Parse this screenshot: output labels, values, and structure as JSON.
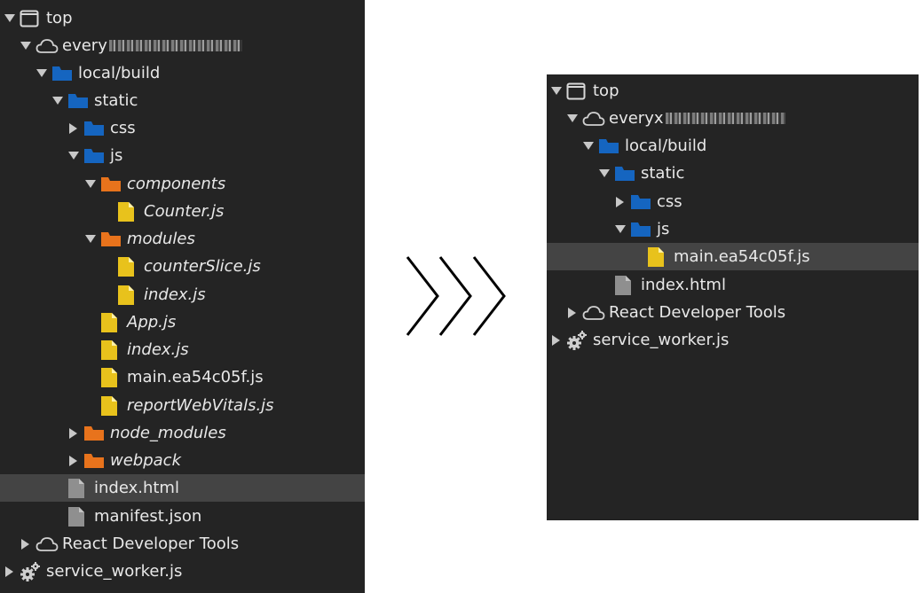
{
  "left": {
    "rows": [
      {
        "label": "top"
      },
      {
        "label": "every"
      },
      {
        "label": "local/build"
      },
      {
        "label": "static"
      },
      {
        "label": "css"
      },
      {
        "label": "js"
      },
      {
        "label": "components"
      },
      {
        "label": "Counter.js"
      },
      {
        "label": "modules"
      },
      {
        "label": "counterSlice.js"
      },
      {
        "label": "index.js"
      },
      {
        "label": "App.js"
      },
      {
        "label": "index.js"
      },
      {
        "label": "main.ea54c05f.js"
      },
      {
        "label": "reportWebVitals.js"
      },
      {
        "label": "node_modules"
      },
      {
        "label": "webpack"
      },
      {
        "label": "index.html"
      },
      {
        "label": "manifest.json"
      },
      {
        "label": "React Developer Tools"
      },
      {
        "label": "service_worker.js"
      }
    ]
  },
  "right": {
    "rows": [
      {
        "label": "top"
      },
      {
        "label": "everyx"
      },
      {
        "label": "local/build"
      },
      {
        "label": "static"
      },
      {
        "label": "css"
      },
      {
        "label": "js"
      },
      {
        "label": "main.ea54c05f.js"
      },
      {
        "label": "index.html"
      },
      {
        "label": "React Developer Tools"
      },
      {
        "label": "service_worker.js"
      }
    ]
  },
  "colors": {
    "panel_bg": "#242424",
    "selected_bg": "#444444",
    "text": "#e8e8e8",
    "folder_blue": "#1565c0",
    "folder_orange": "#e8731c",
    "file_yellow": "#e8c21c",
    "file_gray": "#8f8f8f"
  }
}
